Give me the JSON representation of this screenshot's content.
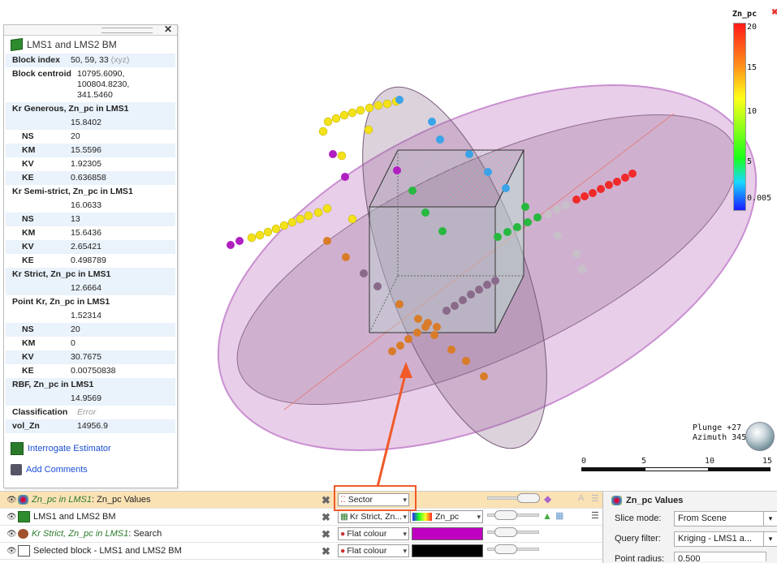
{
  "info_panel": {
    "title": "LMS1 and LMS2 BM",
    "rows": [
      {
        "k": "Block index",
        "v": "50, 59, 33",
        "extra": "(xyz)"
      },
      {
        "k": "Block centroid",
        "v": "10795.6090, 100804.8230,",
        "v2": "341.5460"
      },
      {
        "k": "Kr Generous, Zn_pc in LMS1",
        "v": "15.8402"
      },
      {
        "k": "NS",
        "v": "20"
      },
      {
        "k": "KM",
        "v": "15.5596"
      },
      {
        "k": "KV",
        "v": "1.92305"
      },
      {
        "k": "KE",
        "v": "0.636858"
      },
      {
        "k": "Kr Semi-strict, Zn_pc in LMS1",
        "v": "16.0633"
      },
      {
        "k": "NS",
        "v": "13"
      },
      {
        "k": "KM",
        "v": "15.6436"
      },
      {
        "k": "KV",
        "v": "2.65421"
      },
      {
        "k": "KE",
        "v": "0.498789"
      },
      {
        "k": "Kr Strict, Zn_pc in LMS1",
        "v": "12.6664"
      },
      {
        "k": "Point Kr, Zn_pc in LMS1",
        "v": "1.52314"
      },
      {
        "k": "NS",
        "v": "20"
      },
      {
        "k": "KM",
        "v": "0"
      },
      {
        "k": "KV",
        "v": "30.7675"
      },
      {
        "k": "KE",
        "v": "0.00750838"
      },
      {
        "k": "RBF, Zn_pc in LMS1",
        "v": "14.9569"
      },
      {
        "k": "Classification",
        "v": "Error"
      },
      {
        "k": "vol_Zn",
        "v": "14956.9"
      }
    ],
    "link_interrogate": "Interrogate Estimator",
    "link_comments": "Add Comments"
  },
  "legend": {
    "title": "Zn_pc",
    "ticks": [
      "20",
      "15",
      "10",
      "5",
      "0.005"
    ]
  },
  "view": {
    "plunge": "Plunge +27",
    "azimuth": "Azimuth 345",
    "scale_ticks": [
      "0",
      "5",
      "10",
      "15"
    ]
  },
  "layers": [
    {
      "name_italic": "Zn_pc in LMS1",
      "name_rest": ": Zn_pc Values",
      "combo": "Sector",
      "selected": true
    },
    {
      "name_italic": "",
      "name_rest": "LMS1 and LMS2 BM",
      "combo": "Kr Strict, Zn...",
      "combo2": "Zn_pc",
      "selected": false
    },
    {
      "name_italic": "Kr Strict, Zn_pc in LMS1",
      "name_rest": ": Search",
      "combo": "Flat colour",
      "selected": false
    },
    {
      "name_italic": "",
      "name_rest": "Selected block - LMS1 and LMS2 BM",
      "combo": "Flat colour",
      "selected": false
    }
  ],
  "colors": {
    "layer3_swatch": "#c000c0",
    "layer4_swatch": "#000000",
    "highlight": "#f05a28"
  },
  "properties": {
    "title": "Zn_pc Values",
    "slice_mode_label": "Slice mode:",
    "slice_mode_value": "From Scene",
    "query_filter_label": "Query filter:",
    "query_filter_value": "Kriging - LMS1 a...",
    "point_radius_label": "Point radius:",
    "point_radius_value": "0.500"
  }
}
